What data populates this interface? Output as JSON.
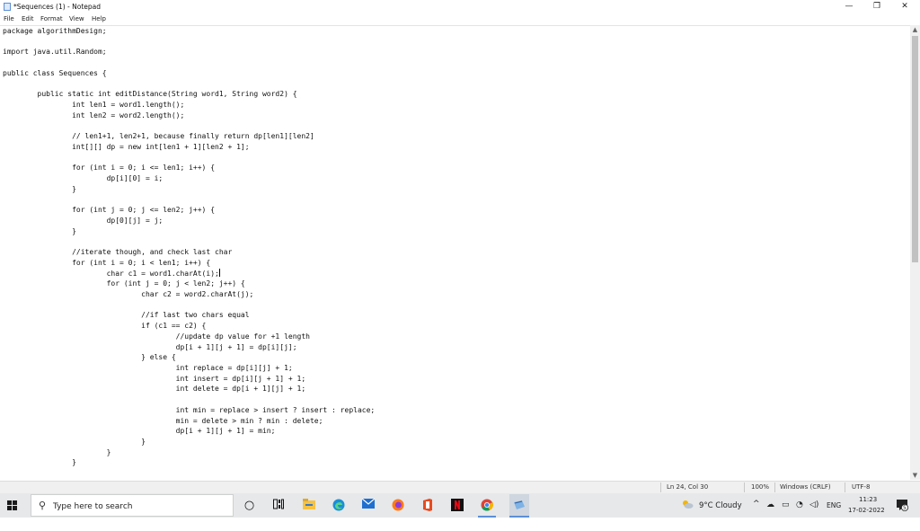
{
  "window": {
    "title": "*Sequences (1) - Notepad",
    "minimize": "—",
    "maximize": "❐",
    "close": "✕"
  },
  "menu": [
    "File",
    "Edit",
    "Format",
    "View",
    "Help"
  ],
  "code": "package algorithmDesign;\n\nimport java.util.Random;\n\npublic class Sequences {\n\n\tpublic static int editDistance(String word1, String word2) {\n\t\tint len1 = word1.length();\n\t\tint len2 = word2.length();\n\n\t\t// len1+1, len2+1, because finally return dp[len1][len2]\n\t\tint[][] dp = new int[len1 + 1][len2 + 1];\n\n\t\tfor (int i = 0; i <= len1; i++) {\n\t\t\tdp[i][0] = i;\n\t\t}\n\n\t\tfor (int j = 0; j <= len2; j++) {\n\t\t\tdp[0][j] = j;\n\t\t}\n\n\t\t//iterate though, and check last char\n\t\tfor (int i = 0; i < len1; i++) {\n\t\t\tchar c1 = word1.charAt(i);\n\t\t\tfor (int j = 0; j < len2; j++) {\n\t\t\t\tchar c2 = word2.charAt(j);\n\n\t\t\t\t//if last two chars equal\n\t\t\t\tif (c1 == c2) {\n\t\t\t\t\t//update dp value for +1 length\n\t\t\t\t\tdp[i + 1][j + 1] = dp[i][j];\n\t\t\t\t} else {\n\t\t\t\t\tint replace = dp[i][j] + 1;\n\t\t\t\t\tint insert = dp[i][j + 1] + 1;\n\t\t\t\t\tint delete = dp[i + 1][j] + 1;\n\n\t\t\t\t\tint min = replace > insert ? insert : replace;\n\t\t\t\t\tmin = delete > min ? min : delete;\n\t\t\t\t\tdp[i + 1][j + 1] = min;\n\t\t\t\t}\n\t\t\t}\n\t\t}",
  "caret_line": 24,
  "status": {
    "position": "Ln 24, Col 30",
    "zoom": "100%",
    "line_ending": "Windows (CRLF)",
    "encoding": "UTF-8"
  },
  "taskbar": {
    "search_placeholder": "Type here to search",
    "apps": [
      "cortana-icon",
      "task-view-icon",
      "file-explorer-icon",
      "edge-icon",
      "mail-icon",
      "firefox-icon",
      "office-icon",
      "netflix-icon",
      "chrome-icon",
      "notepad-icon"
    ],
    "weather": "9°C  Cloudy",
    "language": "ENG",
    "time": "11:23",
    "date": "17-02-2022",
    "notifications": "5"
  },
  "colors": {
    "accent": "#5b8fd6",
    "taskbar_bg": "#e6e8ea"
  }
}
